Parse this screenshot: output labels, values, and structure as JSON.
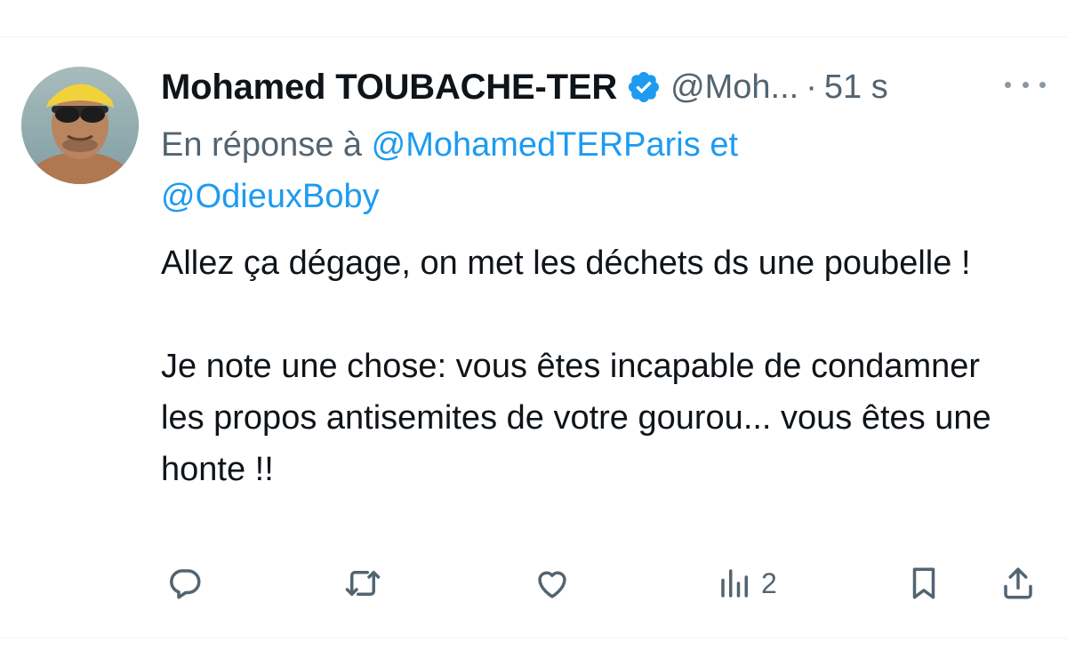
{
  "tweet": {
    "author_name": "Mohamed TOUBACHE-TER",
    "handle": "@Moh...",
    "separator": "·",
    "time": "51 s",
    "reply_prefix": "En réponse à",
    "reply_mention_1": "@MohamedTERParis",
    "reply_joiner": "et",
    "reply_mention_2": "@OdieuxBoby",
    "body_paragraph_1": "Allez ça dégage, on met les déchets ds une poubelle !",
    "body_paragraph_2": "Je note une chose: vous êtes incapable de condamner les propos antisemites de votre gourou... vous êtes une honte !!"
  },
  "actions": {
    "views_count": "2"
  },
  "icons": {
    "verified": "verified-badge-icon",
    "more": "more-options-icon",
    "reply": "reply-icon",
    "retweet": "retweet-icon",
    "like": "like-icon",
    "views": "views-icon",
    "bookmark": "bookmark-icon",
    "share": "share-icon"
  },
  "colors": {
    "text_primary": "#0f1419",
    "text_secondary": "#536471",
    "link": "#1d9bf0",
    "verified": "#1d9bf0",
    "divider": "#eff3f4"
  }
}
